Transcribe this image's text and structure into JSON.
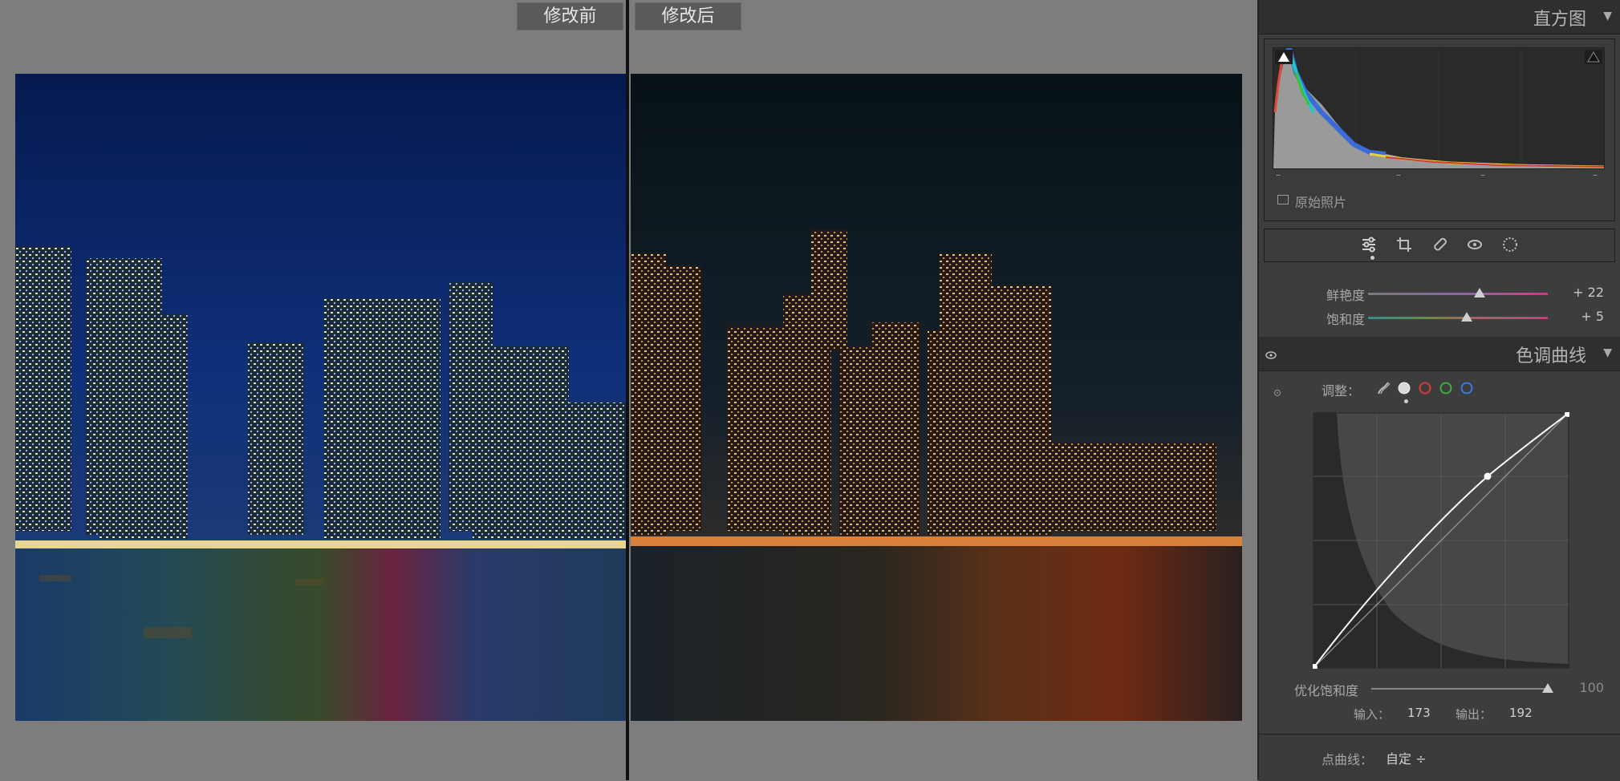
{
  "compare": {
    "before_label": "修改前",
    "after_label": "修改后"
  },
  "histogram": {
    "title": "直方图",
    "original_photo_label": "原始照片"
  },
  "tools": [
    "sliders-icon",
    "crop-icon",
    "heal-brush-icon",
    "red-eye-icon",
    "mask-icon"
  ],
  "basic": {
    "vibrance": {
      "label": "鲜艳度",
      "value": "+ 22",
      "level": 0.62
    },
    "saturation": {
      "label": "饱和度",
      "value": "+ 5",
      "level": 0.55
    }
  },
  "tone_curve": {
    "title": "色调曲线",
    "adjust_label": "调整：",
    "channels": [
      "point-curve",
      "rgb",
      "red",
      "green",
      "blue"
    ],
    "refine_saturation_label": "优化饱和度",
    "refine_saturation_value": "100",
    "refine_saturation_level": 1.0,
    "input_label": "输入：",
    "input_value": "173",
    "output_label": "输出：",
    "output_value": "192",
    "point_curve_label": "点曲线：",
    "point_curve_value": "自定 ÷"
  },
  "colors": {
    "panel_bg": "#3d3d3d",
    "header_bg": "#2f2f2f",
    "stage_bg": "#7d7d7d",
    "label_bg": "#5a5a5a"
  }
}
